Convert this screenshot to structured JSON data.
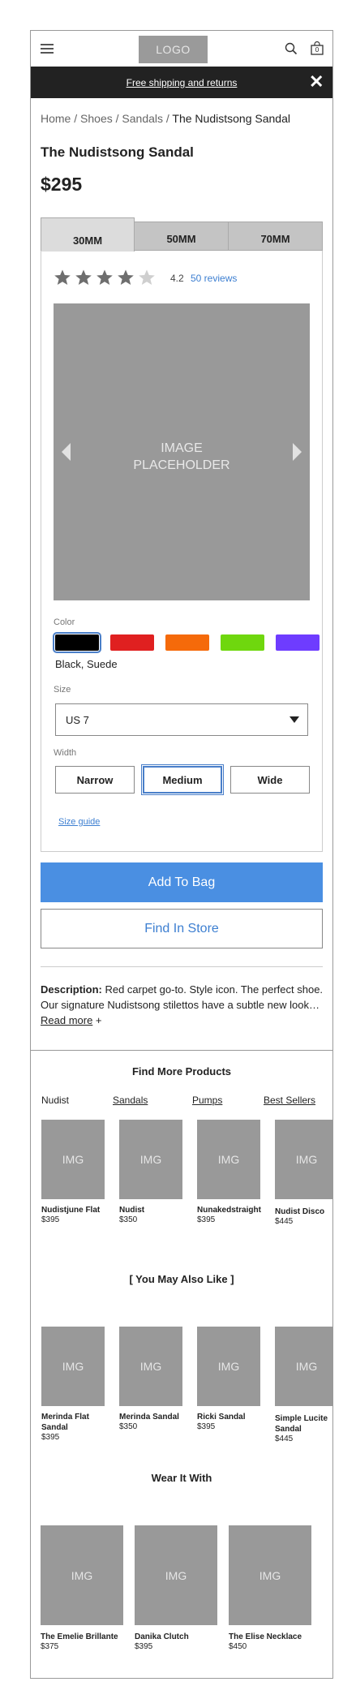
{
  "header": {
    "logo": "LOGO",
    "bag_count": "0"
  },
  "banner": {
    "text": "Free shipping and returns",
    "close": "✕"
  },
  "breadcrumb": {
    "items": [
      "Home",
      "Shoes",
      "Sandals"
    ],
    "separator": " / ",
    "current": "The Nudistsong Sandal"
  },
  "product": {
    "title": "The Nudistsong Sandal",
    "price": "$295",
    "tabs": [
      "30MM",
      "50MM",
      "70MM"
    ],
    "rating": "4.2",
    "rating_value": 4,
    "reviews": "50 reviews",
    "image_text_1": "IMAGE",
    "image_text_2": "PLACEHOLDER",
    "color_label": "Color",
    "colors": [
      "#000000",
      "#e02020",
      "#f56a0a",
      "#6fd70e",
      "#6e3cff"
    ],
    "color_name": "Black, Suede",
    "size_label": "Size",
    "size_value": "US 7",
    "width_label": "Width",
    "widths": [
      "Narrow",
      "Medium",
      "Wide"
    ],
    "size_guide": "Size guide",
    "add_to_bag": "Add To Bag",
    "find_in_store": "Find In Store",
    "description_label": "Description:",
    "description_text": " Red carpet go-to. Style icon. The perfect shoe. Our signature Nudistsong stilettos have a subtle new look… ",
    "read_more": "Read more",
    "plus": " +"
  },
  "find_more": {
    "title": "Find More Products",
    "links": [
      "Nudist",
      "Sandals",
      "Pumps",
      "Best Sellers"
    ],
    "img": "IMG",
    "items": [
      {
        "name": "Nudistjune Flat",
        "price": "$395"
      },
      {
        "name": "Nudist",
        "price": "$350"
      },
      {
        "name": "Nunakedstraight",
        "price": "$395"
      },
      {
        "name": "Nudist Disco",
        "price": "$445"
      }
    ]
  },
  "also_like": {
    "title": "[ You May Also Like ]",
    "img": "IMG",
    "items": [
      {
        "name": "Merinda Flat Sandal",
        "price": "$395"
      },
      {
        "name": "Merinda Sandal",
        "price": "$350"
      },
      {
        "name": "Ricki Sandal",
        "price": "$395"
      },
      {
        "name": "Simple Lucite Sandal",
        "price": "$445"
      }
    ]
  },
  "wear_with": {
    "title": "Wear It With",
    "img": "IMG",
    "items": [
      {
        "name": "The Emelie Brillante",
        "price": "$375"
      },
      {
        "name": "Danika Clutch",
        "price": "$395"
      },
      {
        "name": "The Elise Necklace",
        "price": "$450"
      }
    ]
  }
}
